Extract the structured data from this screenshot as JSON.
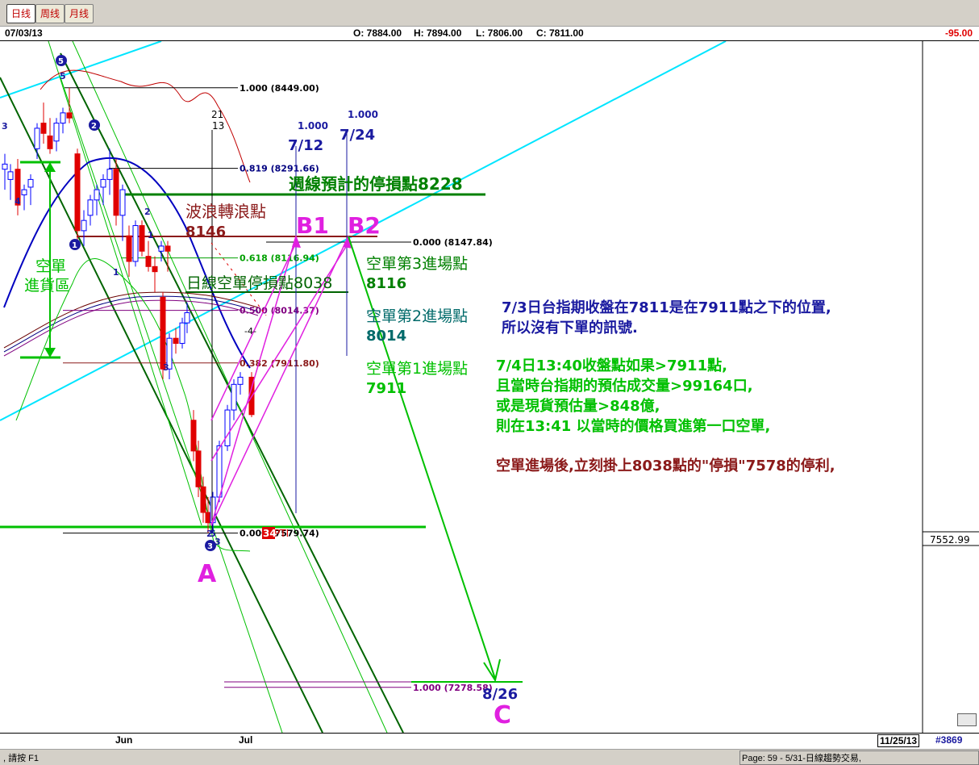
{
  "tabs": [
    {
      "label": "日线",
      "active": true
    },
    {
      "label": "周线",
      "active": false
    },
    {
      "label": "月线",
      "active": false
    }
  ],
  "header": {
    "date": "07/03/13",
    "open": "O: 7884.00",
    "high": "H: 7894.00",
    "low": "L: 7806.00",
    "close": "C: 7811.00",
    "change": "-95.00"
  },
  "x_axis": {
    "labels": [
      "Jun",
      "Jul"
    ],
    "end_date": "11/25/13",
    "bar_count": "#3869"
  },
  "y_axis": {
    "price_readout": "7552.99"
  },
  "status": {
    "left": ", 請按 F1",
    "right": "Page: 59 - 5/31-日線趨勢交易,"
  },
  "colors": {
    "up": "#0000ff",
    "down": "#e00000",
    "fib": "#8b1a1a",
    "cyan": "#00e5ff",
    "green": "#00c000",
    "darkgreen": "#006400",
    "magenta": "#e020e0",
    "navy": "#1a1aa0"
  },
  "chart_data": {
    "type": "candlestick",
    "ylim": [
      7190,
      8540
    ],
    "fib_levels": [
      {
        "label": "1.000 (8449.00)",
        "value": 8449.0
      },
      {
        "label": "0.819 (8291.66)",
        "value": 8291.66
      },
      {
        "label": "0.000 (8147.84)",
        "value": 8147.84
      },
      {
        "label": "0.618 (8116.94)",
        "value": 8116.94
      },
      {
        "label": "0.500 (8014.37)",
        "value": 8014.37
      },
      {
        "label": "0.382 (7911.80)",
        "value": 7911.8
      },
      {
        "label": "0.000 (7579.74)",
        "value": 7579.74
      },
      {
        "label": "1.000 (7278.58)",
        "value": 7278.58
      }
    ],
    "candles": [
      {
        "o": 8290,
        "h": 8320,
        "l": 8250,
        "c": 8300
      },
      {
        "o": 8270,
        "h": 8300,
        "l": 8230,
        "c": 8285
      },
      {
        "o": 8290,
        "h": 8310,
        "l": 8200,
        "c": 8220
      },
      {
        "o": 8240,
        "h": 8260,
        "l": 8210,
        "c": 8250
      },
      {
        "o": 8255,
        "h": 8280,
        "l": 8220,
        "c": 8270
      },
      {
        "o": 8330,
        "h": 8380,
        "l": 8310,
        "c": 8370
      },
      {
        "o": 8380,
        "h": 8420,
        "l": 8340,
        "c": 8360
      },
      {
        "o": 8355,
        "h": 8390,
        "l": 8320,
        "c": 8330
      },
      {
        "o": 8345,
        "h": 8390,
        "l": 8325,
        "c": 8380
      },
      {
        "o": 8380,
        "h": 8410,
        "l": 8360,
        "c": 8400
      },
      {
        "o": 8400,
        "h": 8449,
        "l": 8380,
        "c": 8390
      },
      {
        "o": 8320,
        "h": 8330,
        "l": 8150,
        "c": 8170
      },
      {
        "o": 8170,
        "h": 8210,
        "l": 8140,
        "c": 8190
      },
      {
        "o": 8200,
        "h": 8240,
        "l": 8180,
        "c": 8230
      },
      {
        "o": 8230,
        "h": 8260,
        "l": 8200,
        "c": 8250
      },
      {
        "o": 8255,
        "h": 8280,
        "l": 8220,
        "c": 8270
      },
      {
        "o": 8270,
        "h": 8330,
        "l": 8240,
        "c": 8290
      },
      {
        "o": 8290,
        "h": 8310,
        "l": 8180,
        "c": 8200
      },
      {
        "o": 8200,
        "h": 8260,
        "l": 8150,
        "c": 8250
      },
      {
        "o": 8160,
        "h": 8180,
        "l": 8080,
        "c": 8110
      },
      {
        "o": 8110,
        "h": 8190,
        "l": 8100,
        "c": 8180
      },
      {
        "o": 8180,
        "h": 8190,
        "l": 8120,
        "c": 8130
      },
      {
        "o": 8120,
        "h": 8150,
        "l": 8090,
        "c": 8100
      },
      {
        "o": 8100,
        "h": 8120,
        "l": 8050,
        "c": 8090
      },
      {
        "o": 8130,
        "h": 8150,
        "l": 8110,
        "c": 8140
      },
      {
        "o": 8140,
        "h": 8150,
        "l": 8090,
        "c": 8130
      },
      {
        "o": 8040,
        "h": 8050,
        "l": 7880,
        "c": 7900
      },
      {
        "o": 7900,
        "h": 7970,
        "l": 7880,
        "c": 7960
      },
      {
        "o": 7960,
        "h": 7980,
        "l": 7930,
        "c": 7950
      },
      {
        "o": 7950,
        "h": 8000,
        "l": 7940,
        "c": 7990
      },
      {
        "o": 7990,
        "h": 8030,
        "l": 7970,
        "c": 8010
      },
      {
        "o": 7800,
        "h": 7820,
        "l": 7720,
        "c": 7740
      },
      {
        "o": 7740,
        "h": 7760,
        "l": 7650,
        "c": 7670
      },
      {
        "o": 7670,
        "h": 7690,
        "l": 7600,
        "c": 7620
      },
      {
        "o": 7620,
        "h": 7650,
        "l": 7580,
        "c": 7600
      },
      {
        "o": 7600,
        "h": 7660,
        "l": 7580,
        "c": 7650
      },
      {
        "o": 7650,
        "h": 7760,
        "l": 7640,
        "c": 7750
      },
      {
        "o": 7750,
        "h": 7830,
        "l": 7740,
        "c": 7820
      },
      {
        "o": 7820,
        "h": 7880,
        "l": 7800,
        "c": 7870
      },
      {
        "o": 7870,
        "h": 7894,
        "l": 7850,
        "c": 7884
      },
      {
        "o": 7884,
        "h": 7894,
        "l": 7806,
        "c": 7811
      }
    ],
    "annotations": [
      "週線預計的停損點8228",
      "波浪轉浪點",
      "8146",
      "B1",
      "B2",
      "空單第3進場點",
      "8116",
      "空單第2進場點",
      "8014",
      "空單第1進場點",
      "7911",
      "日線空單停損點8038",
      "空單",
      "進貨區",
      "A",
      "C",
      "7/12",
      "7/24",
      "8/26",
      "1.000",
      "1.000",
      "21",
      "13",
      "PTI",
      "34",
      "-4-"
    ],
    "notes": [
      "7/3日台指期收盤在7811是在7911點之下的位置,",
      "所以沒有下單的訊號.",
      "7/4日13:40收盤點如果>7911點,",
      "且當時台指期的預估成交量>99164口,",
      "或是現貨預估量>848億,",
      "則在13:41 以當時的價格買進第一口空單,",
      "空單進場後,立刻掛上8038點的\"停損\"7578的停利,"
    ],
    "wave_labels": [
      "3",
      "4",
      "5",
      "1",
      "2",
      "1",
      "2",
      "3",
      "5",
      "3"
    ]
  }
}
